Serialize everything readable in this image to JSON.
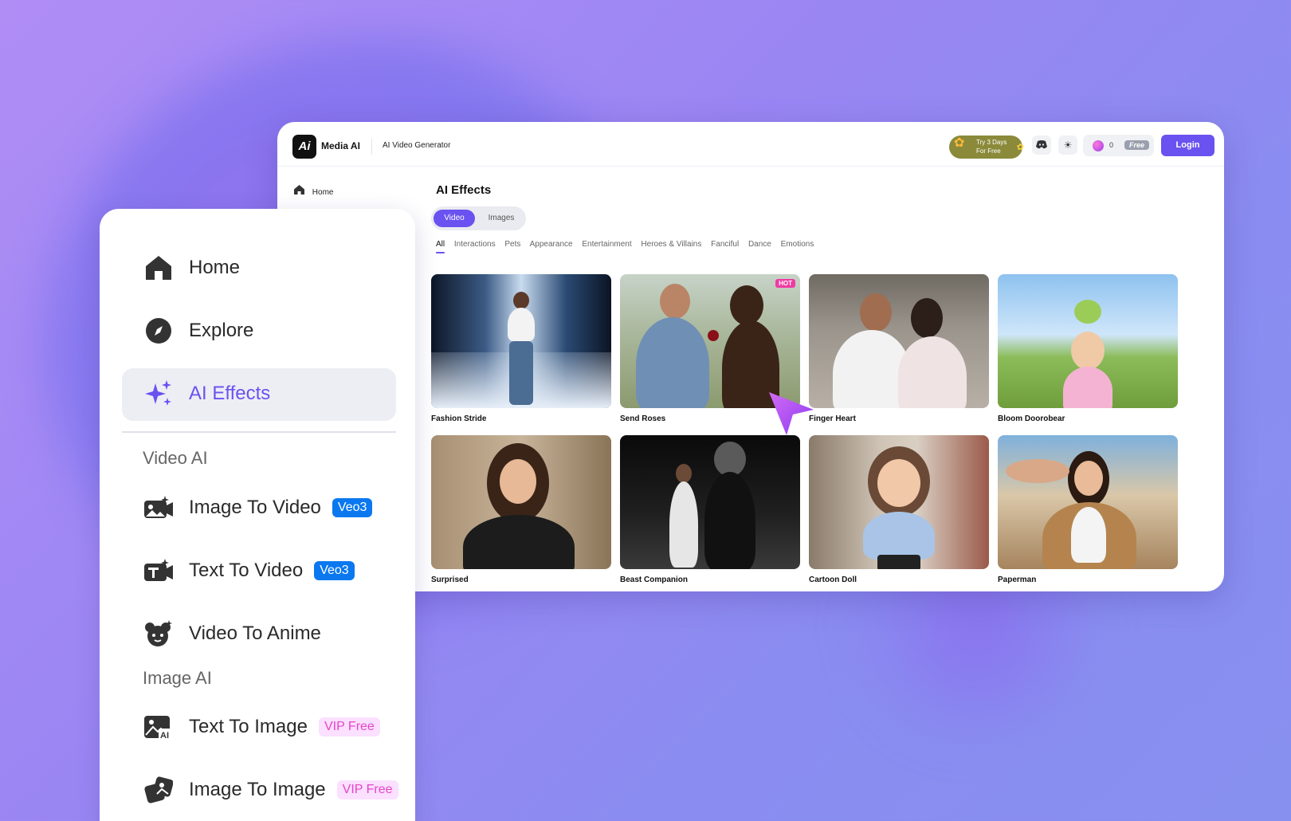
{
  "header": {
    "brand": "Media AI",
    "logo_text": "Ai",
    "app_title": "AI Video Generator",
    "trial_line1": "Try 3 Days",
    "trial_line2": "For Free",
    "credits": "0",
    "plan_badge": "Free",
    "login_label": "Login"
  },
  "window_nav": {
    "home_label": "Home"
  },
  "main": {
    "title": "AI Effects",
    "toggle": {
      "video": "Video",
      "images": "Images"
    },
    "categories": [
      "All",
      "Interactions",
      "Pets",
      "Appearance",
      "Entertainment",
      "Heroes & Villains",
      "Fanciful",
      "Dance",
      "Emotions"
    ],
    "hot_badge": "HOT",
    "cards": [
      "Fashion Stride",
      "Send Roses",
      "Finger Heart",
      "Bloom Doorobear",
      "Surprised",
      "Beast Companion",
      "Cartoon Doll",
      "Paperman"
    ]
  },
  "sidebar": {
    "home": "Home",
    "explore": "Explore",
    "ai_effects": "AI Effects",
    "video_ai_heading": "Video AI",
    "image_to_video": "Image To Video",
    "text_to_video": "Text To Video",
    "video_to_anime": "Video To Anime",
    "image_ai_heading": "Image AI",
    "text_to_image": "Text To Image",
    "image_to_image": "Image To Image",
    "veo_badge": "Veo3",
    "vip_badge": "VIP Free"
  },
  "colors": {
    "accent": "#6a52f0",
    "hot": "#ef3aa4",
    "veo": "#0b78f0",
    "vip_text": "#e346c8"
  }
}
